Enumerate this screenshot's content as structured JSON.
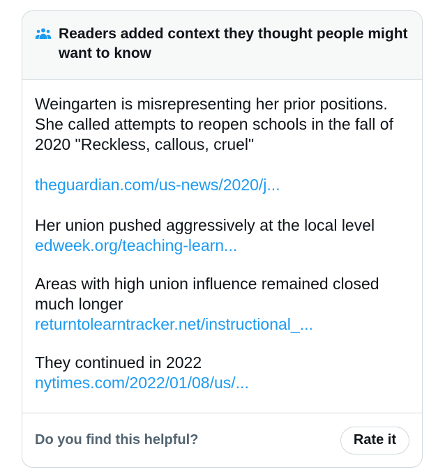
{
  "note": {
    "header": {
      "icon": "people-icon",
      "title": "Readers added context they thought people might want to know"
    },
    "sections": [
      {
        "text": "Weingarten is misrepresenting her prior positions. She called attempts to reopen schools in the fall of 2020 \"Reckless, callous, cruel\"",
        "link": "theguardian.com/us-news/2020/j..."
      },
      {
        "text": "Her union pushed aggressively at the local level",
        "link": "edweek.org/teaching-learn..."
      },
      {
        "text": "Areas with high union influence remained closed much longer",
        "link": "returntolearntracker.net/instructional_..."
      },
      {
        "text": "They continued in 2022",
        "link": "nytimes.com/2022/01/08/us/..."
      }
    ],
    "footer": {
      "question": "Do you find this helpful?",
      "rate_label": "Rate it"
    },
    "colors": {
      "link": "#1d9bf0",
      "header_bg": "#f7f9f9",
      "border": "#cfd9de",
      "muted_text": "#536471"
    }
  }
}
